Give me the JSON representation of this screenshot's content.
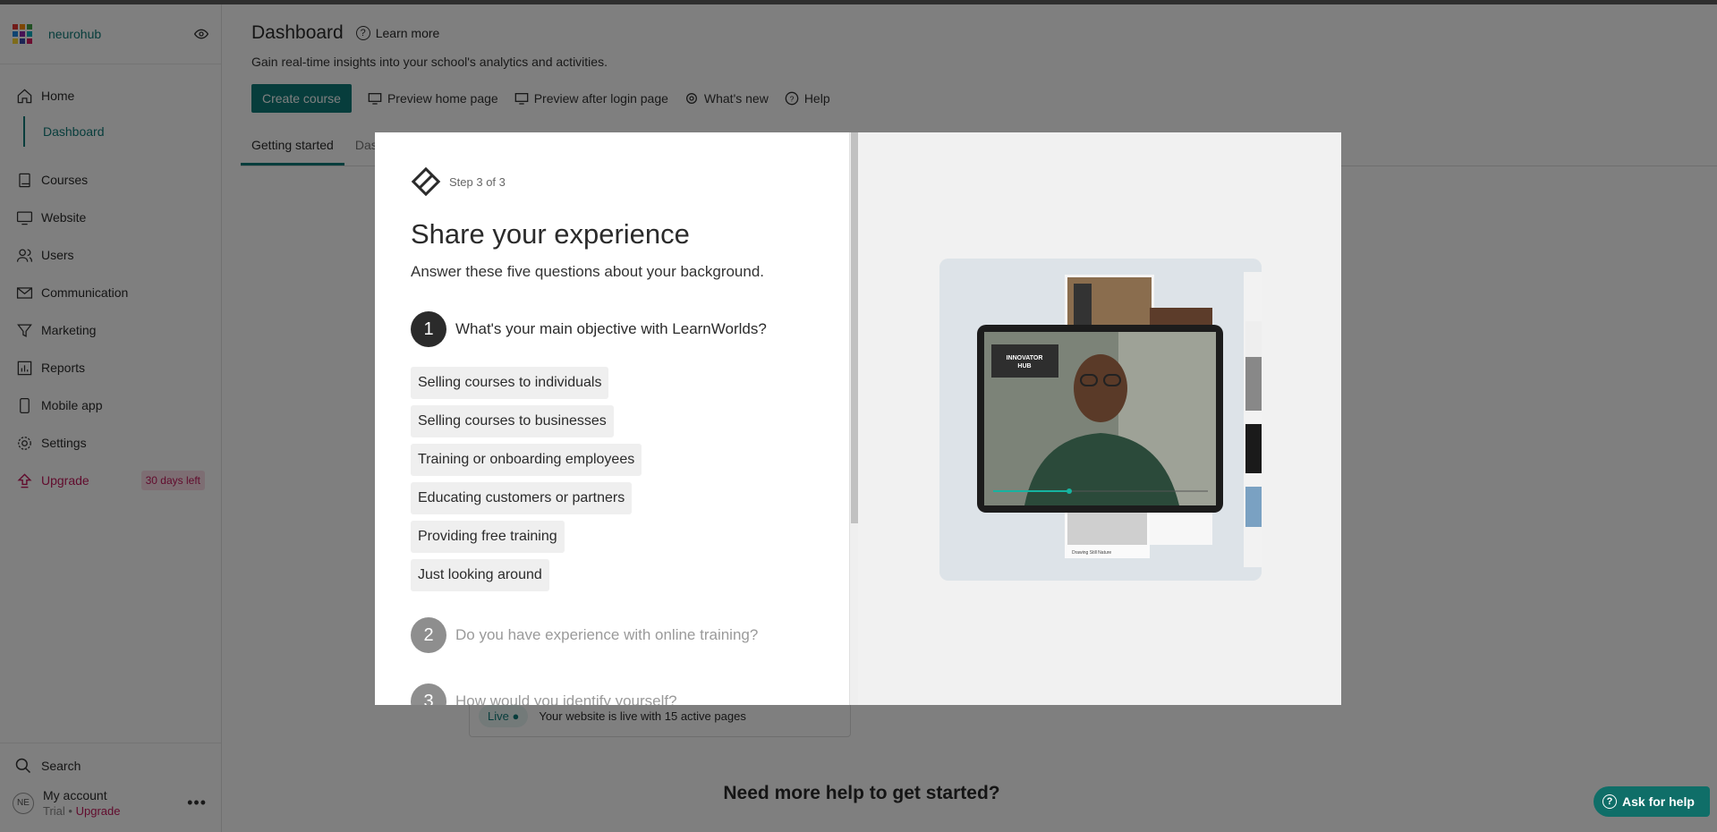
{
  "app": {
    "brand": "neurohub",
    "brand_colors": [
      "#e53935",
      "#fb8c00",
      "#43a047",
      "#1e88e5",
      "#8e24aa",
      "#00acc1",
      "#fdd835",
      "#3949ab",
      "#d81b60"
    ]
  },
  "sidebar": {
    "items": [
      {
        "label": "Home",
        "icon": "home-icon"
      },
      {
        "label": "Courses",
        "icon": "book-icon"
      },
      {
        "label": "Website",
        "icon": "monitor-icon"
      },
      {
        "label": "Users",
        "icon": "users-icon"
      },
      {
        "label": "Communication",
        "icon": "mail-icon"
      },
      {
        "label": "Marketing",
        "icon": "funnel-icon"
      },
      {
        "label": "Reports",
        "icon": "chart-icon"
      },
      {
        "label": "Mobile app",
        "icon": "phone-icon"
      },
      {
        "label": "Settings",
        "icon": "gear-icon"
      },
      {
        "label": "Upgrade",
        "icon": "upgrade-icon"
      }
    ],
    "sub_item": "Dashboard",
    "trial_badge": "30 days left",
    "search_label": "Search",
    "account": {
      "initials": "NE",
      "name": "My account",
      "trial": "Trial",
      "separator": "•",
      "upgrade": "Upgrade"
    }
  },
  "header": {
    "title": "Dashboard",
    "learn_more": "Learn more",
    "subtitle": "Gain real-time insights into your school's analytics and activities.",
    "create_course": "Create course",
    "links": [
      "Preview home page",
      "Preview after login page",
      "What's new",
      "Help"
    ],
    "tabs": [
      "Getting started",
      "Dashboard"
    ]
  },
  "background": {
    "live_tag": "Live",
    "live_text": "Your website is live with 15 active pages",
    "help_heading": "Need more help to get started?",
    "ask_for_help": "Ask for help"
  },
  "modal": {
    "step": "Step 3 of 3",
    "title": "Share your experience",
    "subtitle": "Answer these five questions about your background.",
    "questions": [
      {
        "num": "1",
        "text": "What's your main objective with LearnWorlds?"
      },
      {
        "num": "2",
        "text": "Do you have experience with online training?"
      },
      {
        "num": "3",
        "text": "How would you identify yourself?"
      }
    ],
    "options": [
      "Selling courses to individuals",
      "Selling courses to businesses",
      "Training or onboarding employees",
      "Educating customers or partners",
      "Providing free training",
      "Just looking around"
    ],
    "illustration": {
      "logo_line1": "INNOVATOR",
      "logo_line2": "HUB",
      "card_label": "Drawing Still Nature"
    }
  },
  "colors": {
    "accent": "#0f7a78",
    "upgrade": "#c2185b",
    "help_button": "#16b3a0"
  }
}
